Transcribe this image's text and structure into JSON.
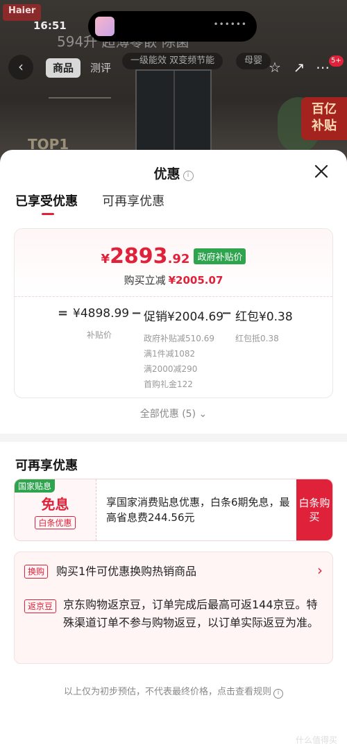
{
  "background": {
    "logo": "Haier",
    "time": "16:51",
    "headline": "594升 超薄零嵌 除菌",
    "tabs": [
      "商品",
      "测评"
    ],
    "chips": [
      "一级能效 双变频节能",
      "母婴"
    ],
    "cart_count": "5+",
    "subsidy_badge_line1": "百亿",
    "subsidy_badge_line2": "补贴",
    "top1": "TOP1"
  },
  "sheet": {
    "title": "优惠",
    "tabs": [
      {
        "label": "已享受优惠",
        "active": true
      },
      {
        "label": "可再享优惠",
        "active": false
      }
    ],
    "price": {
      "yen": "¥",
      "integer": "2893",
      "decimal": ".92",
      "tag": "政府补贴价",
      "instant_cut_label": "购买立减",
      "instant_cut_amount": "¥2005.07"
    },
    "formula": {
      "eq": "=",
      "minus": "−",
      "base_value": "¥4898.99",
      "base_label": "补贴价",
      "promo_value": "促销¥2004.69",
      "promo_details": [
        "政府补贴减510.69",
        "满1件减1082",
        "满2000减290",
        "首购礼金122"
      ],
      "redpacket_value": "红包¥0.38",
      "redpacket_detail": "红包抵0.38"
    },
    "all_offers": "全部优惠 (5)",
    "more_section_title": "可再享优惠",
    "coupon": {
      "flag": "国家贴息",
      "name": "免息",
      "sub": "白条优惠",
      "desc": "享国家消费贴息优惠，白条6期免息，最高省息费244.56元",
      "button": "白条购买"
    },
    "perks": [
      {
        "tag": "换购",
        "text": "购买1件可优惠换购热销商品"
      },
      {
        "tag": "返京豆",
        "text": "京东购物返京豆，订单完成后最高可返144京豆。特殊渠道订单不参与购物返豆，以订单实际返豆为准。"
      }
    ],
    "footnote": "以上仅为初步预估，不代表最终价格，点击查看规则",
    "watermark": "什么值得买"
  },
  "colors": {
    "accent": "#e0213a",
    "green": "#2ea44f"
  }
}
